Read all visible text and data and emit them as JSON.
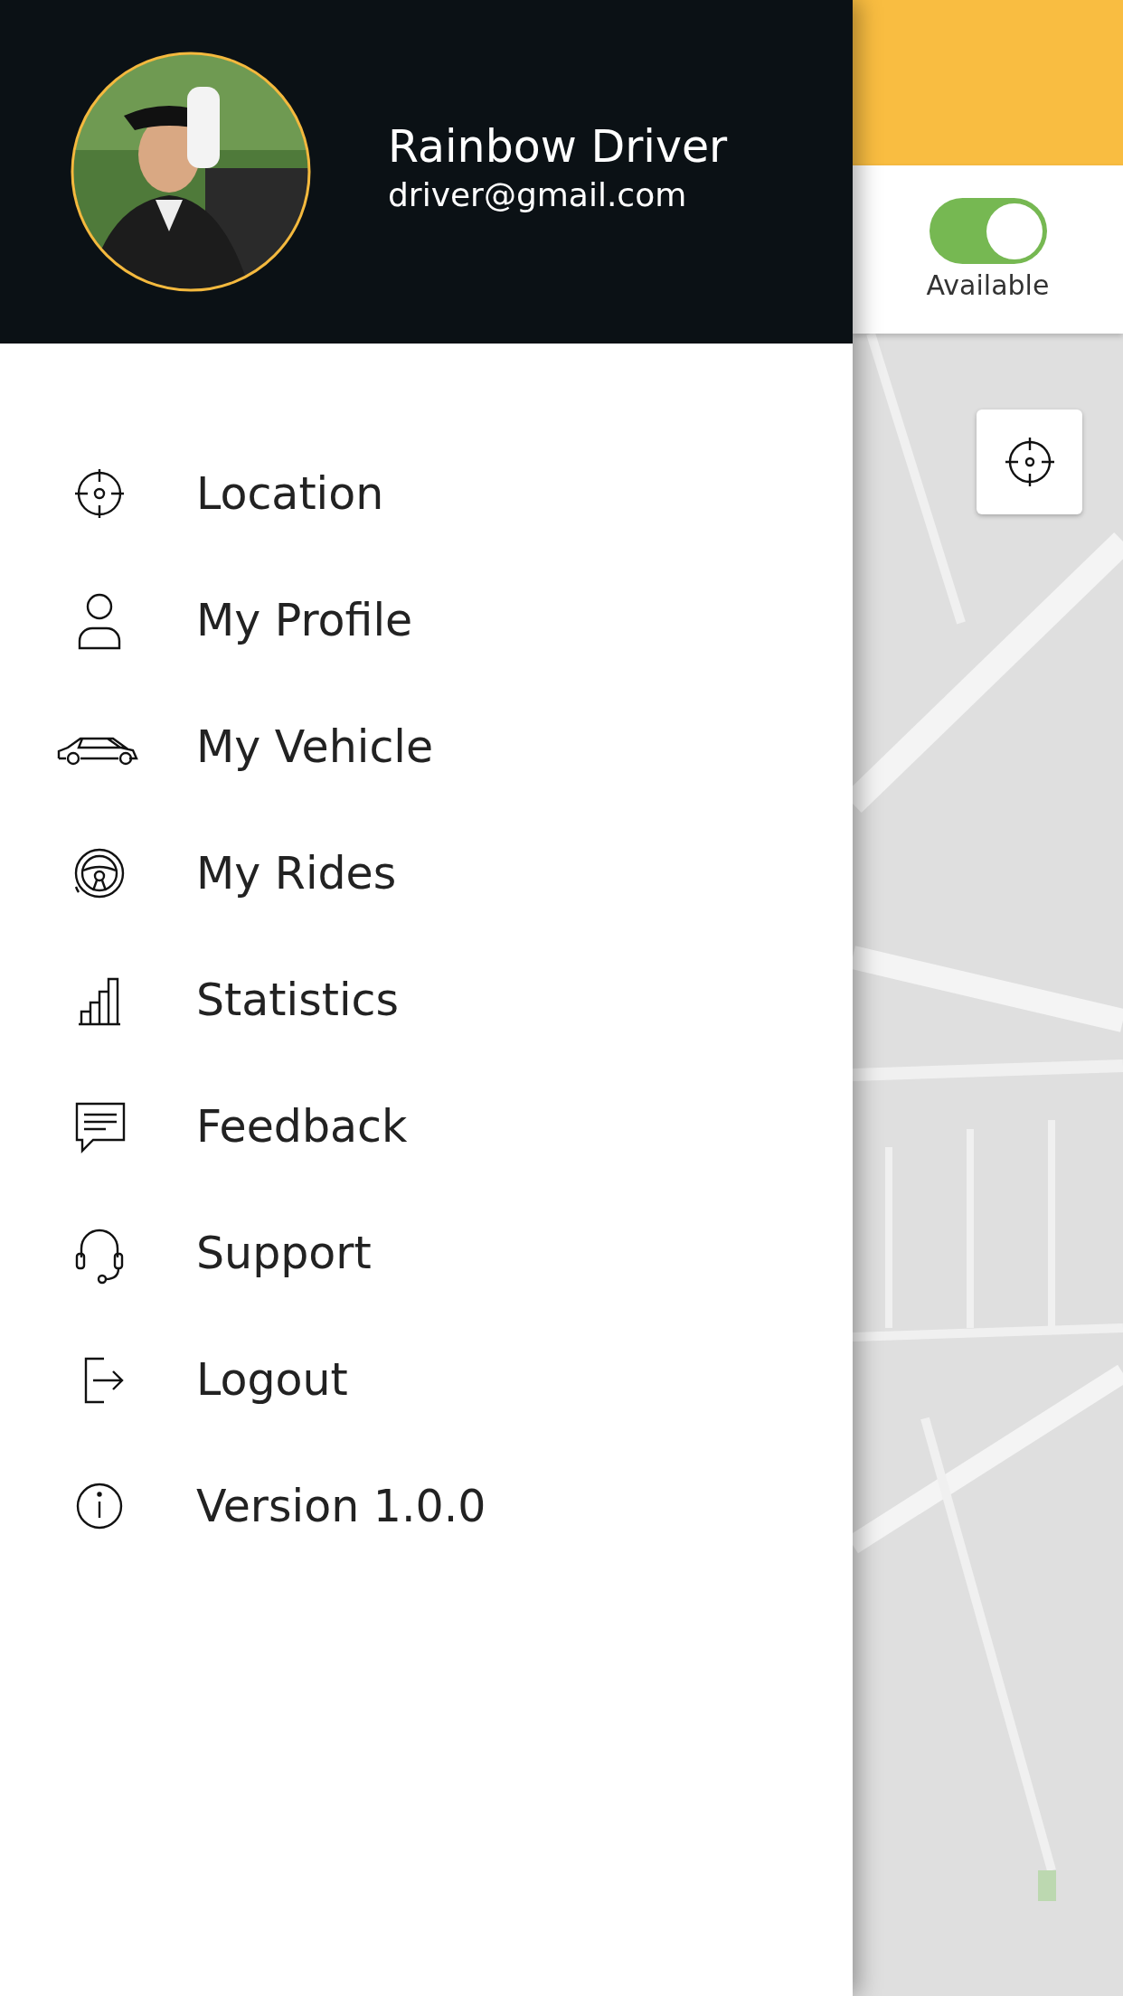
{
  "drawer": {
    "header": {
      "name": "Rainbow Driver",
      "email": "driver@gmail.com"
    },
    "menu": [
      {
        "kind": "location",
        "label": "Location"
      },
      {
        "kind": "profile",
        "label": "My Profile"
      },
      {
        "kind": "vehicle",
        "label": "My Vehicle"
      },
      {
        "kind": "rides",
        "label": "My Rides"
      },
      {
        "kind": "statistics",
        "label": "Statistics"
      },
      {
        "kind": "feedback",
        "label": "Feedback"
      },
      {
        "kind": "support",
        "label": "Support"
      },
      {
        "kind": "logout",
        "label": "Logout"
      },
      {
        "kind": "version",
        "label": "Version 1.0.0"
      }
    ]
  },
  "status": {
    "label": "Available",
    "on": true
  }
}
